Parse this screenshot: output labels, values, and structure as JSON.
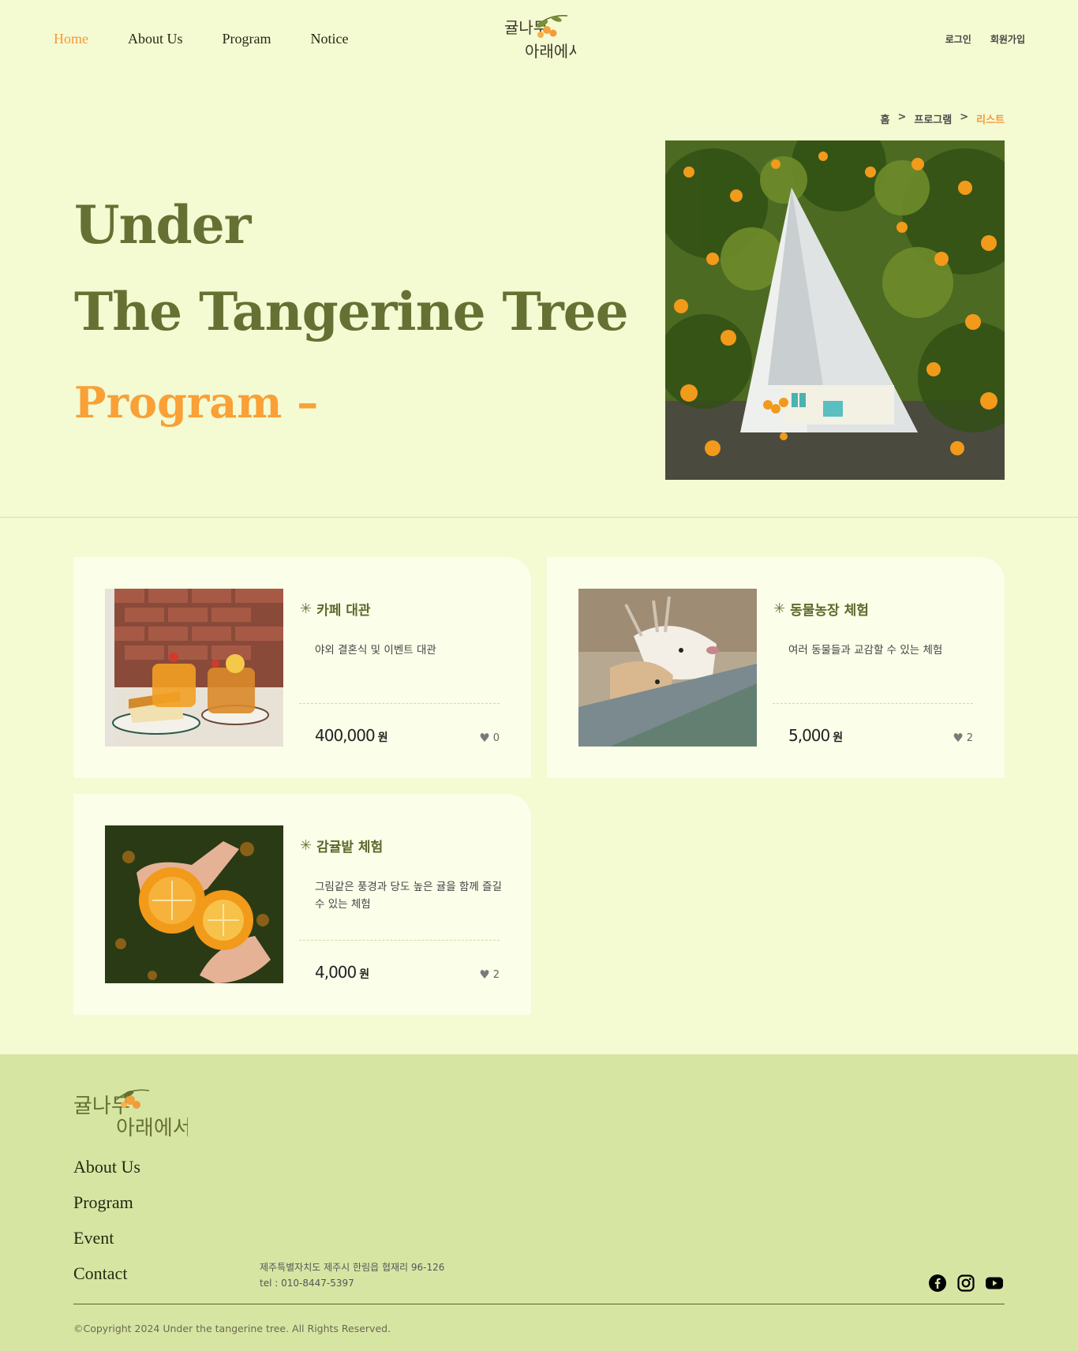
{
  "nav": {
    "items": [
      {
        "label": "Home",
        "active": true
      },
      {
        "label": "About Us",
        "active": false
      },
      {
        "label": "Program",
        "active": false
      },
      {
        "label": "Notice",
        "active": false
      }
    ]
  },
  "logo": {
    "line1": "귤나무",
    "line2": "아래에서"
  },
  "auth": {
    "login": "로그인",
    "signup": "회원가입"
  },
  "breadcrumb": {
    "home": "홈",
    "sep": ">",
    "program": "프로그램",
    "current": "리스트"
  },
  "hero": {
    "line1": "Under",
    "line2": "The Tangerine Tree",
    "program": "Program –"
  },
  "cards": [
    {
      "title": "카페 대관",
      "desc": "야외 결혼식 및 이벤트 대관",
      "price": "400,000",
      "unit": "원",
      "likes": "0",
      "image": "tangerine-drinks-and-cake"
    },
    {
      "title": "동물농장 체험",
      "desc": "여러 동물들과 교감할 수 있는 체험",
      "price": "5,000",
      "unit": "원",
      "likes": "2",
      "image": "deer-at-fence"
    },
    {
      "title": "감귤밭 체험",
      "desc": "그림같은 풍경과 당도 높은 귤을 함께 즐길 수 있는 체험",
      "price": "4,000",
      "unit": "원",
      "likes": "2",
      "image": "peeled-tangerine-in-hands"
    }
  ],
  "footer": {
    "links": [
      "About Us",
      "Program",
      "Event",
      "Contact"
    ],
    "address": "제주특별자치도 제주시 한림읍 협재리 96-126",
    "tel": "tel : 010-8447-5397",
    "copyright": "©Copyright 2024 Under the tangerine tree. All Rights Reserved.",
    "social": [
      "facebook-icon",
      "instagram-icon",
      "youtube-icon"
    ]
  },
  "colors": {
    "accent": "#f39a3c",
    "olive": "#657133",
    "background": "#f4fad2",
    "footer": "#d7e5a3"
  }
}
